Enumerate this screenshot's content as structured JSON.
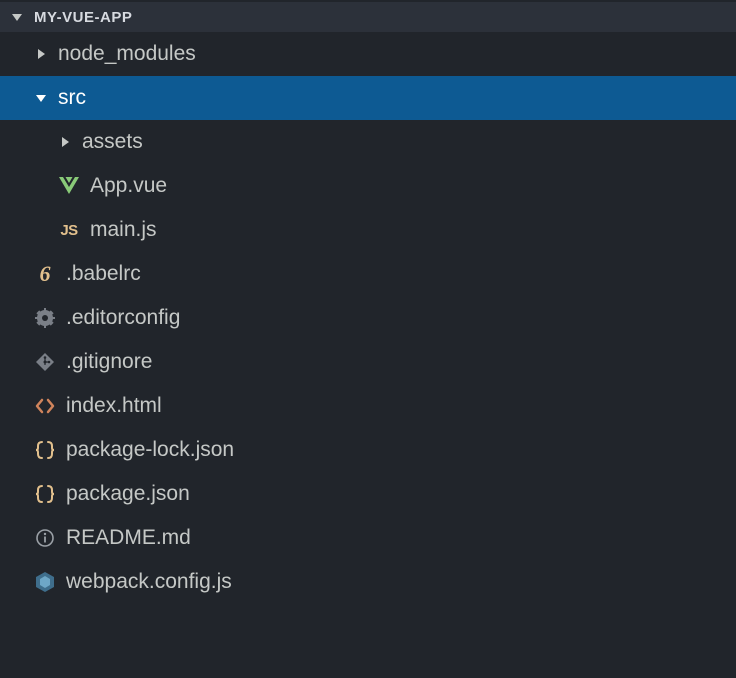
{
  "root": {
    "label": "MY-VUE-APP"
  },
  "items": {
    "node_modules": {
      "label": "node_modules"
    },
    "src": {
      "label": "src"
    },
    "assets": {
      "label": "assets"
    },
    "app_vue": {
      "label": "App.vue"
    },
    "main_js": {
      "label": "main.js",
      "icon_text": "JS"
    },
    "babelrc": {
      "label": ".babelrc",
      "icon_text": "6"
    },
    "editorconfig": {
      "label": ".editorconfig"
    },
    "gitignore": {
      "label": ".gitignore"
    },
    "index_html": {
      "label": "index.html"
    },
    "pkg_lock": {
      "label": "package-lock.json"
    },
    "pkg": {
      "label": "package.json"
    },
    "readme": {
      "label": "README.md"
    },
    "webpack": {
      "label": "webpack.config.js"
    }
  }
}
